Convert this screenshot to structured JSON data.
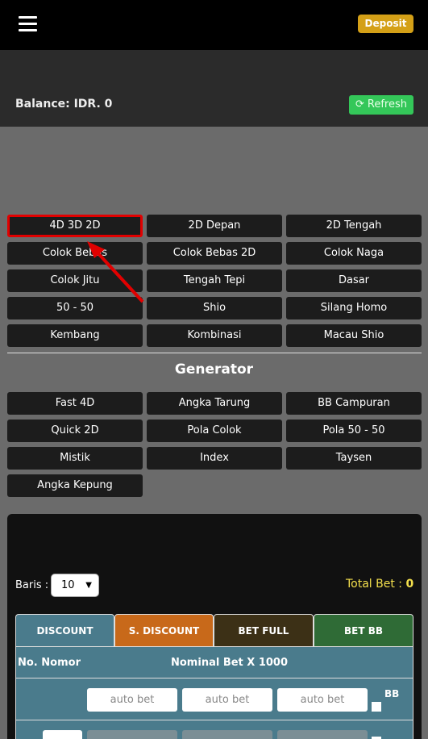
{
  "header": {
    "deposit_label": "Deposit"
  },
  "balance": {
    "text": "Balance: IDR. 0",
    "refresh_label": "Refresh"
  },
  "game_buttons": [
    {
      "label": "4D 3D 2D",
      "active": true
    },
    {
      "label": "2D Depan"
    },
    {
      "label": "2D Tengah"
    },
    {
      "label": "Colok Bebas"
    },
    {
      "label": "Colok Bebas 2D"
    },
    {
      "label": "Colok Naga"
    },
    {
      "label": "Colok Jitu"
    },
    {
      "label": "Tengah Tepi"
    },
    {
      "label": "Dasar"
    },
    {
      "label": "50 - 50"
    },
    {
      "label": "Shio"
    },
    {
      "label": "Silang Homo"
    },
    {
      "label": "Kembang"
    },
    {
      "label": "Kombinasi"
    },
    {
      "label": "Macau Shio"
    }
  ],
  "generator": {
    "title": "Generator",
    "buttons": [
      {
        "label": "Fast 4D"
      },
      {
        "label": "Angka Tarung"
      },
      {
        "label": "BB Campuran"
      },
      {
        "label": "Quick 2D"
      },
      {
        "label": "Pola Colok"
      },
      {
        "label": "Pola 50 - 50"
      },
      {
        "label": "Mistik"
      },
      {
        "label": "Index"
      },
      {
        "label": "Taysen"
      },
      {
        "label": "Angka Kepung"
      }
    ]
  },
  "bet_panel": {
    "baris_label": "Baris :",
    "baris_value": "10",
    "total_bet_label": "Total Bet :",
    "total_bet_value": "0",
    "tabs": [
      "DISCOUNT",
      "S. DISCOUNT",
      "BET FULL",
      "BET BB"
    ],
    "col_no": "No. Nomor",
    "col_nominal": "Nominal Bet X 1000",
    "auto_bet_placeholder": "auto bet",
    "bb_label": "BB"
  },
  "colors": {
    "deposit": "#d4a017",
    "refresh": "#34c759",
    "highlight": "#e10000",
    "tab_discount": "#4a7b8c",
    "tab_sdiscount": "#c8691a",
    "tab_betfull": "#3c3016",
    "tab_betbb": "#2f6b36",
    "total_bet": "#f4e04d"
  }
}
